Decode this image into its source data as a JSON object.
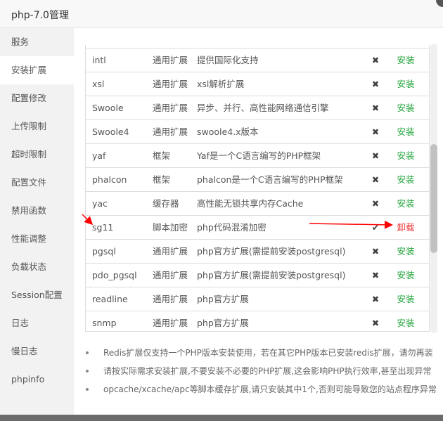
{
  "window": {
    "title": "php-7.0管理"
  },
  "sidebar": {
    "items": [
      {
        "label": "服务"
      },
      {
        "label": "安装扩展",
        "active": true
      },
      {
        "label": "配置修改"
      },
      {
        "label": "上传限制"
      },
      {
        "label": "超时限制"
      },
      {
        "label": "配置文件"
      },
      {
        "label": "禁用函数"
      },
      {
        "label": "性能调整"
      },
      {
        "label": "负载状态"
      },
      {
        "label": "Session配置"
      },
      {
        "label": "日志"
      },
      {
        "label": "慢日志"
      },
      {
        "label": "phpinfo"
      }
    ]
  },
  "table": {
    "rows": [
      {
        "name": "intl",
        "type": "通用扩展",
        "desc": "提供国际化支持",
        "status": "✖",
        "action": "安装"
      },
      {
        "name": "xsl",
        "type": "通用扩展",
        "desc": "xsl解析扩展",
        "status": "✖",
        "action": "安装"
      },
      {
        "name": "Swoole",
        "type": "通用扩展",
        "desc": "异步、并行、高性能网络通信引擎",
        "status": "✖",
        "action": "安装"
      },
      {
        "name": "Swoole4",
        "type": "通用扩展",
        "desc": "swoole4.x版本",
        "status": "✖",
        "action": "安装"
      },
      {
        "name": "yaf",
        "type": "框架",
        "desc": "Yaf是一个C语言编写的PHP框架",
        "status": "✖",
        "action": "安装"
      },
      {
        "name": "phalcon",
        "type": "框架",
        "desc": "phalcon是一个C语言编写的PHP框架",
        "status": "✖",
        "action": "安装"
      },
      {
        "name": "yac",
        "type": "缓存器",
        "desc": "高性能无锁共享内存Cache",
        "status": "✖",
        "action": "安装"
      },
      {
        "name": "sg11",
        "type": "脚本加密",
        "desc": "php代码混淆加密",
        "status": "✔",
        "action": "卸载"
      },
      {
        "name": "pgsql",
        "type": "通用扩展",
        "desc": "php官方扩展(需提前安装postgresql)",
        "status": "✖",
        "action": "安装"
      },
      {
        "name": "pdo_pgsql",
        "type": "通用扩展",
        "desc": "php官方扩展(需提前安装postgresql)",
        "status": "✖",
        "action": "安装"
      },
      {
        "name": "readline",
        "type": "通用扩展",
        "desc": "php官方扩展",
        "status": "✖",
        "action": "安装"
      },
      {
        "name": "snmp",
        "type": "通用扩展",
        "desc": "php官方扩展",
        "status": "✖",
        "action": "安装"
      }
    ]
  },
  "notes": [
    "Redis扩展仅支持一个PHP版本安装使用，若在其它PHP版本已安装redis扩展，请勿再装",
    "请按实际需求安装扩展,不要安装不必要的PHP扩展,这会影响PHP执行效率,甚至出现异常",
    "opcache/xcache/apc等脚本缓存扩展,请只安装其中1个,否则可能导致您的站点程序异常"
  ],
  "colors": {
    "install": "#20a53a",
    "uninstall": "#ee3333",
    "annotation": "#ff0000"
  }
}
